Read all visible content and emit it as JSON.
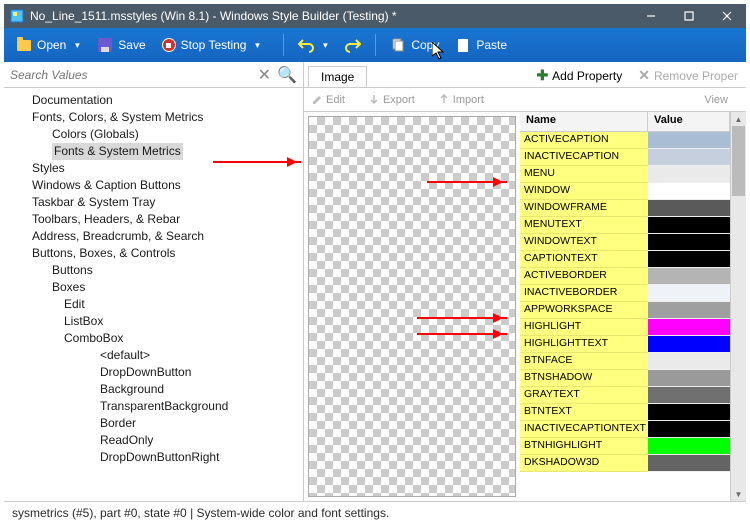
{
  "title": "No_Line_1511.msstyles (Win 8.1) - Windows Style Builder (Testing) *",
  "toolbar": {
    "open": "Open",
    "save": "Save",
    "stop": "Stop Testing",
    "copy": "Copy",
    "paste": "Paste"
  },
  "search": {
    "placeholder": "Search Values"
  },
  "tree": [
    {
      "t": "Documentation",
      "lvl": 1
    },
    {
      "t": "Fonts, Colors, & System Metrics",
      "lvl": 1
    },
    {
      "t": "Colors (Globals)",
      "lvl": 2
    },
    {
      "t": "Fonts & System Metrics",
      "lvl": 2,
      "sel": true
    },
    {
      "t": "Styles",
      "lvl": 1
    },
    {
      "t": "Windows & Caption Buttons",
      "lvl": 1
    },
    {
      "t": "Taskbar & System Tray",
      "lvl": 1
    },
    {
      "t": "Toolbars, Headers, & Rebar",
      "lvl": 1
    },
    {
      "t": "Address, Breadcrumb, & Search",
      "lvl": 1
    },
    {
      "t": "Buttons, Boxes, & Controls",
      "lvl": 1
    },
    {
      "t": "Buttons",
      "lvl": 2
    },
    {
      "t": "Boxes",
      "lvl": 2
    },
    {
      "t": "Edit",
      "lvl": 3
    },
    {
      "t": "ListBox",
      "lvl": 3
    },
    {
      "t": "ComboBox",
      "lvl": 3
    },
    {
      "t": "<default>",
      "lvl": 5
    },
    {
      "t": "DropDownButton",
      "lvl": 5
    },
    {
      "t": "Background",
      "lvl": 5
    },
    {
      "t": "TransparentBackground",
      "lvl": 5
    },
    {
      "t": "Border",
      "lvl": 5
    },
    {
      "t": "ReadOnly",
      "lvl": 5
    },
    {
      "t": "DropDownButtonRight",
      "lvl": 5
    }
  ],
  "tabs": {
    "image": "Image"
  },
  "addprop": "Add Property",
  "remprop": "Remove Proper",
  "imgbar": {
    "edit": "Edit",
    "export": "Export",
    "import": "Import",
    "view": "View"
  },
  "propcols": {
    "name": "Name",
    "value": "Value"
  },
  "props": [
    {
      "n": "ACTIVECAPTION",
      "c": "#a9bdd5"
    },
    {
      "n": "INACTIVECAPTION",
      "c": "#c5cfdd"
    },
    {
      "n": "MENU",
      "c": "#eaeaea"
    },
    {
      "n": "WINDOW",
      "c": "#ffffff"
    },
    {
      "n": "WINDOWFRAME",
      "c": "#5a5a5a"
    },
    {
      "n": "MENUTEXT",
      "c": "#000000"
    },
    {
      "n": "WINDOWTEXT",
      "c": "#000000"
    },
    {
      "n": "CAPTIONTEXT",
      "c": "#000000"
    },
    {
      "n": "ACTIVEBORDER",
      "c": "#b4b4b4"
    },
    {
      "n": "INACTIVEBORDER",
      "c": "#eff3f7"
    },
    {
      "n": "APPWORKSPACE",
      "c": "#9f9f9f"
    },
    {
      "n": "HIGHLIGHT",
      "c": "#ff00ff"
    },
    {
      "n": "HIGHLIGHTTEXT",
      "c": "#0000ff"
    },
    {
      "n": "BTNFACE",
      "c": "#eaeaea"
    },
    {
      "n": "BTNSHADOW",
      "c": "#9a9a9a"
    },
    {
      "n": "GRAYTEXT",
      "c": "#707070"
    },
    {
      "n": "BTNTEXT",
      "c": "#000000"
    },
    {
      "n": "INACTIVECAPTIONTEXT",
      "c": "#000000"
    },
    {
      "n": "BTNHIGHLIGHT",
      "c": "#00ff00"
    },
    {
      "n": "DKSHADOW3D",
      "c": "#646464"
    }
  ],
  "status": "sysmetrics (#5),  part #0,  state #0  |  System-wide color and font settings."
}
